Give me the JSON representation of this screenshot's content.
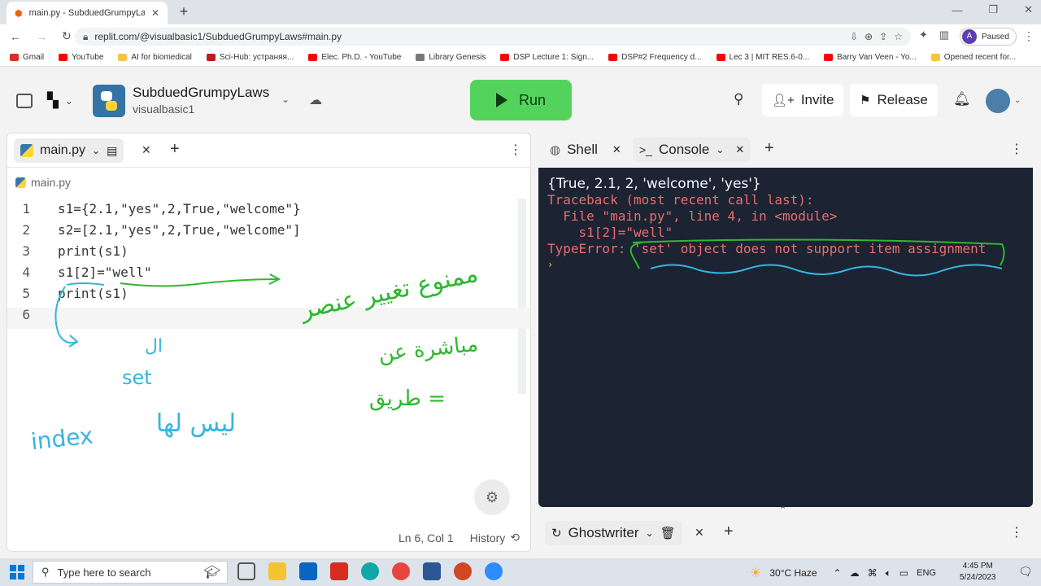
{
  "browser": {
    "tab_title": "main.py - SubduedGrumpyLaws",
    "url": "replit.com/@visualbasic1/SubduedGrumpyLaws#main.py",
    "profile_status": "Paused",
    "profile_initial": "A",
    "bookmarks": [
      {
        "label": "Gmail",
        "color": "#d93025"
      },
      {
        "label": "YouTube",
        "color": "#ff0000"
      },
      {
        "label": "AI for biomedical",
        "color": "#f6c342"
      },
      {
        "label": "Sci-Hub: устраняя...",
        "color": "#b91c1c"
      },
      {
        "label": "Elec. Ph.D. - YouTube",
        "color": "#ff0000"
      },
      {
        "label": "Library Genesis",
        "color": "#777777"
      },
      {
        "label": "DSP Lecture 1: Sign...",
        "color": "#ff0000"
      },
      {
        "label": "DSP#2 Frequency d...",
        "color": "#ff0000"
      },
      {
        "label": "Lec 3 | MIT RES.6-0...",
        "color": "#ff0000"
      },
      {
        "label": "Barry Van Veen - Yo...",
        "color": "#ff0000"
      },
      {
        "label": "Opened recent for...",
        "color": "#f6c342"
      }
    ]
  },
  "header": {
    "repl_name": "SubduedGrumpyLaws",
    "owner": "visualbasic1",
    "run_label": "Run",
    "invite_label": "Invite",
    "release_label": "Release"
  },
  "editor": {
    "tab_label": "main.py",
    "breadcrumb": "main.py",
    "lines": [
      {
        "n": "1",
        "code": "s1={2.1,\"yes\",2,True,\"welcome\"}"
      },
      {
        "n": "2",
        "code": "s2=[2.1,\"yes\",2,True,\"welcome\"]"
      },
      {
        "n": "3",
        "code": "print(s1)"
      },
      {
        "n": "4",
        "code": "s1[2]=\"well\""
      },
      {
        "n": "5",
        "code": "print(s1)"
      },
      {
        "n": "6",
        "code": ""
      }
    ],
    "cursor_pos": "Ln 6, Col 1",
    "history_label": "History"
  },
  "console": {
    "shell_tab": "Shell",
    "console_tab": "Console",
    "output": "{True, 2.1, 2, 'welcome', 'yes'}",
    "traceback": [
      "Traceback (most recent call last):",
      "  File \"main.py\", line 4, in <module>",
      "    s1[2]=\"well\"",
      "TypeError: 'set' object does not support item assignment"
    ],
    "prompt_symbol": "›"
  },
  "ghostwriter": {
    "tab_label": "Ghostwriter"
  },
  "annotations": {
    "arabic_1": "ممنوع تغيير عنصر",
    "arabic_2": "مباشرة عن",
    "arabic_3": "طريق =",
    "arabic_4": "ال",
    "set_word": "set",
    "arabic_5": "ليس لها",
    "index_word": "index"
  },
  "taskbar": {
    "search_placeholder": "Type here to search",
    "weather": "30°C  Haze",
    "lang": "ENG",
    "time": "4:45 PM",
    "date": "5/24/2023"
  }
}
